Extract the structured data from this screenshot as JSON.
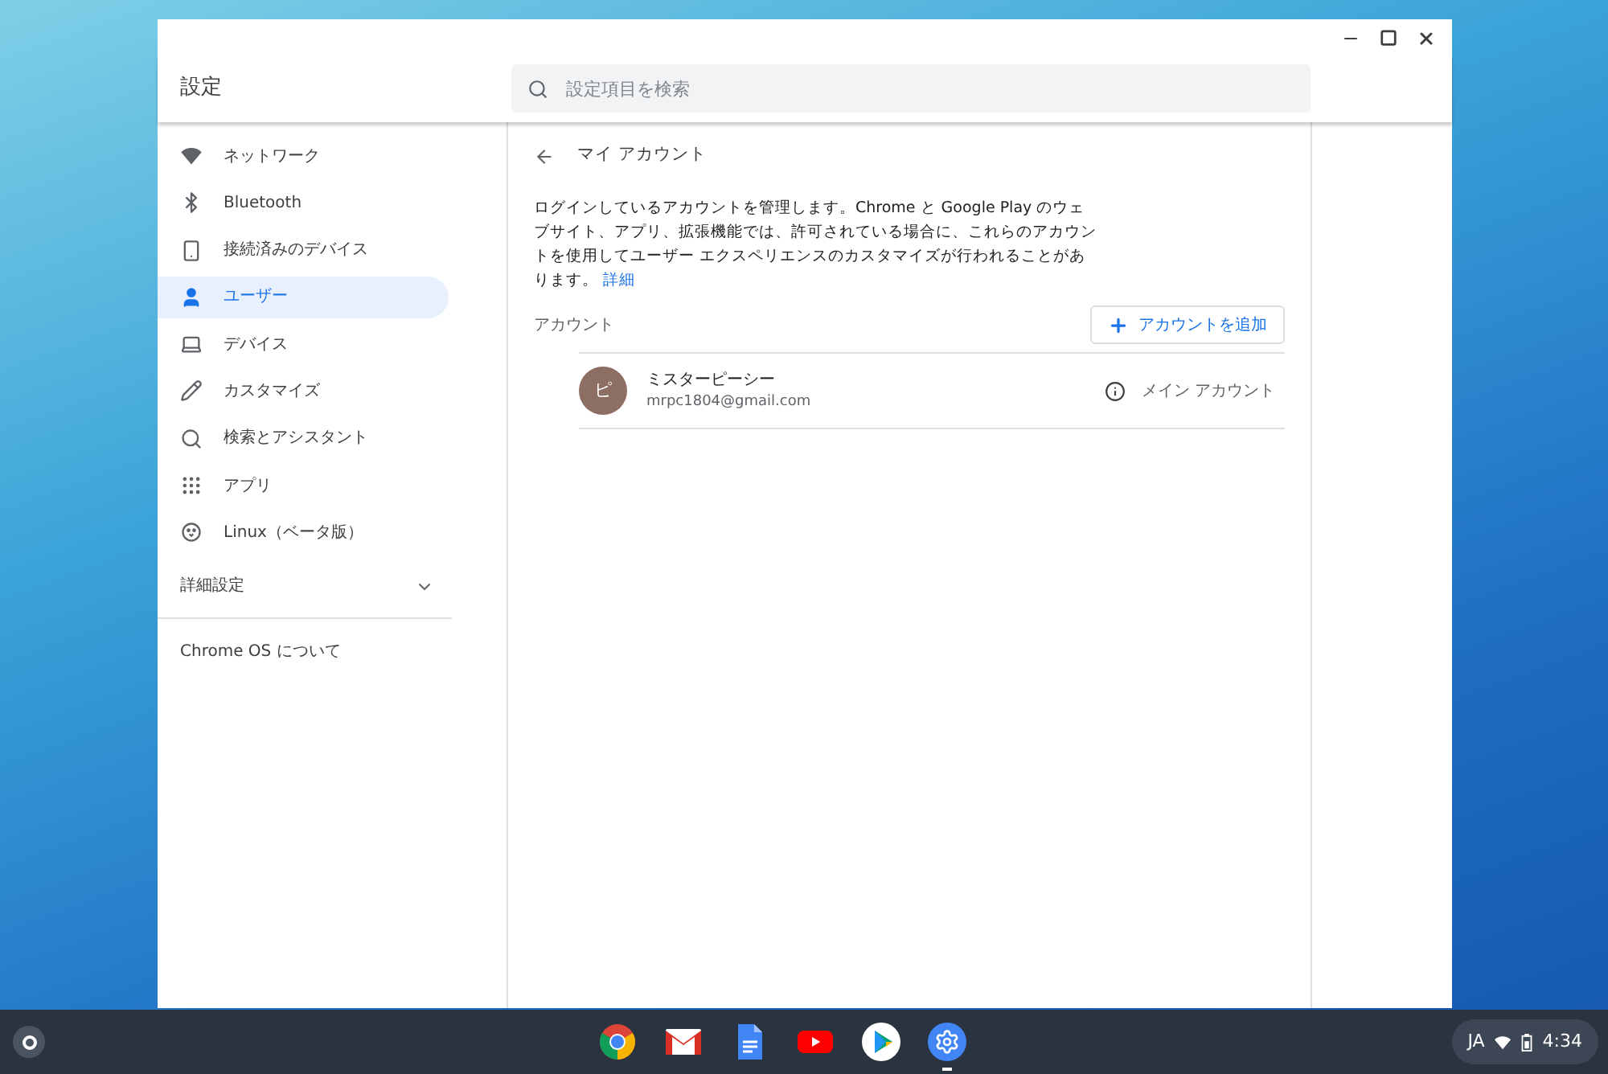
{
  "window": {
    "title": "設定"
  },
  "search": {
    "placeholder": "設定項目を検索"
  },
  "sidebar": {
    "items": [
      {
        "kind": "wifi",
        "label": "ネットワーク",
        "selected": false
      },
      {
        "kind": "bluetooth",
        "label": "Bluetooth",
        "selected": false
      },
      {
        "kind": "phone",
        "label": "接続済みのデバイス",
        "selected": false
      },
      {
        "kind": "person",
        "label": "ユーザー",
        "selected": true
      },
      {
        "kind": "laptop",
        "label": "デバイス",
        "selected": false
      },
      {
        "kind": "brush",
        "label": "カスタマイズ",
        "selected": false
      },
      {
        "kind": "search",
        "label": "検索とアシスタント",
        "selected": false
      },
      {
        "kind": "apps",
        "label": "アプリ",
        "selected": false
      },
      {
        "kind": "linux",
        "label": "Linux（ベータ版）",
        "selected": false
      }
    ],
    "advanced": {
      "label": "詳細設定",
      "expanded": false
    },
    "about": "Chrome OS について"
  },
  "page": {
    "title": "マイ アカウント",
    "description": "ログインしているアカウントを管理します。Chrome と Google Play のウェブサイト、アプリ、拡張機能では、許可されている場合に、これらのアカウントを使用してユーザー エクスペリエンスのカスタマイズが行われることがあります。",
    "link": "詳細",
    "section": "アカウント",
    "add_button": "アカウントを追加",
    "accounts": [
      {
        "initial": "ピ",
        "name": "ミスターピーシー",
        "email": "mrpc1804@gmail.com",
        "color": "#8d6e63",
        "note": "メイン アカウント"
      }
    ]
  },
  "shelf": {
    "apps": [
      {
        "kind": "chrome",
        "selected": false
      },
      {
        "kind": "gmail",
        "selected": false
      },
      {
        "kind": "docs",
        "selected": false
      },
      {
        "kind": "youtube",
        "selected": false
      },
      {
        "kind": "play",
        "selected": false
      },
      {
        "kind": "settings",
        "selected": true
      }
    ],
    "status": {
      "ime": "JA",
      "time": "4:34"
    }
  }
}
